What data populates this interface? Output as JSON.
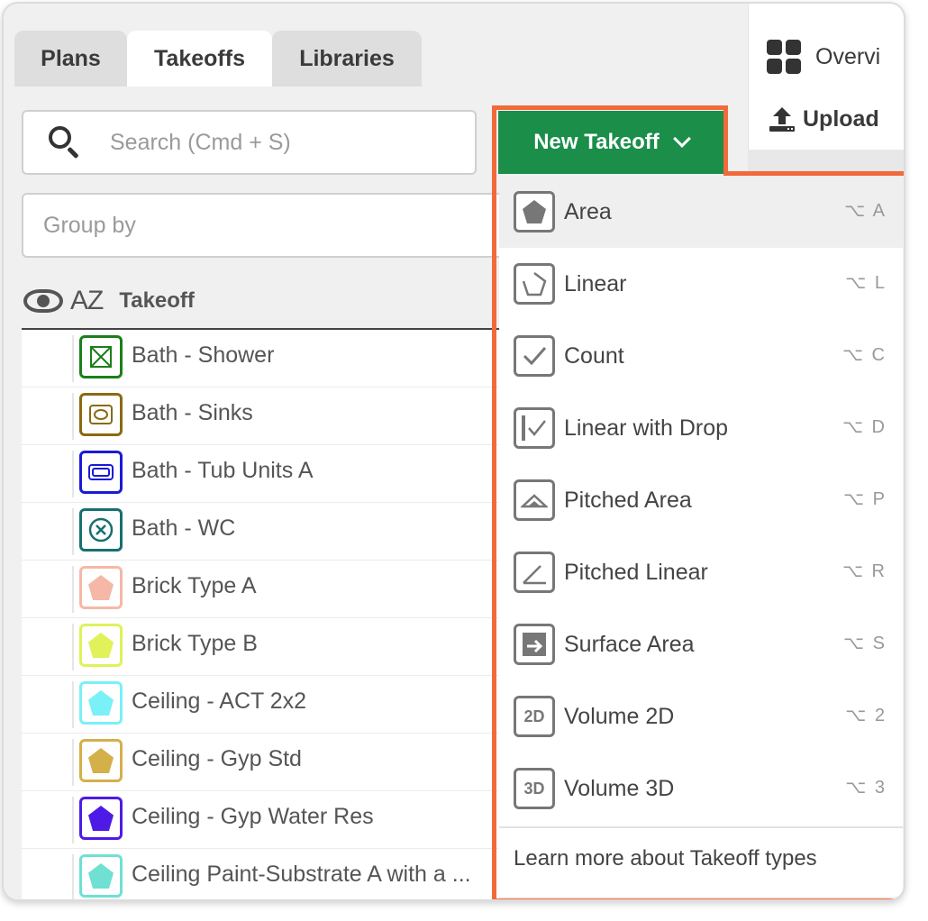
{
  "tabs": [
    {
      "label": "Plans"
    },
    {
      "label": "Takeoffs"
    },
    {
      "label": "Libraries"
    }
  ],
  "active_tab": "Takeoffs",
  "side_panel": {
    "overview_label": "Overvi",
    "upload_label": "Upload"
  },
  "search": {
    "placeholder": "Search (Cmd + S)"
  },
  "group_by": {
    "placeholder": "Group by"
  },
  "list_header": {
    "sort_icon_text": "AZ",
    "column_label": "Takeoff"
  },
  "takeoffs": [
    {
      "label": "Bath - Shower",
      "color": "#1a7f1a",
      "icon": "x-box-icon"
    },
    {
      "label": "Bath - Sinks",
      "color": "#8a6a10",
      "icon": "sink-icon"
    },
    {
      "label": "Bath - Tub Units A",
      "color": "#1a1ad6",
      "icon": "tub-icon"
    },
    {
      "label": "Bath - WC",
      "color": "#17706f",
      "icon": "circle-x-icon"
    },
    {
      "label": "Brick Type A",
      "color": "#f5b8a6",
      "icon": "pentagon-icon"
    },
    {
      "label": "Brick Type B",
      "color": "#e0f15a",
      "icon": "pentagon-icon"
    },
    {
      "label": "Ceiling - ACT 2x2",
      "color": "#7af0f7",
      "icon": "pentagon-icon"
    },
    {
      "label": "Ceiling - Gyp Std",
      "color": "#d4b04a",
      "icon": "pentagon-icon"
    },
    {
      "label": "Ceiling - Gyp Water Res",
      "color": "#4e1be6",
      "icon": "pentagon-icon"
    },
    {
      "label": "Ceiling Paint-Substrate A with a ...",
      "color": "#6fe0d2",
      "icon": "pentagon-icon"
    }
  ],
  "new_takeoff": {
    "button_label": "New Takeoff",
    "items": [
      {
        "label": "Area",
        "shortcut": "⌥ A",
        "icon": "area-icon"
      },
      {
        "label": "Linear",
        "shortcut": "⌥ L",
        "icon": "linear-icon"
      },
      {
        "label": "Count",
        "shortcut": "⌥ C",
        "icon": "count-icon"
      },
      {
        "label": "Linear with Drop",
        "shortcut": "⌥ D",
        "icon": "linear-drop-icon"
      },
      {
        "label": "Pitched Area",
        "shortcut": "⌥ P",
        "icon": "pitched-area-icon"
      },
      {
        "label": "Pitched Linear",
        "shortcut": "⌥ R",
        "icon": "pitched-linear-icon"
      },
      {
        "label": "Surface Area",
        "shortcut": "⌥ S",
        "icon": "surface-area-icon"
      },
      {
        "label": "Volume 2D",
        "shortcut": "⌥ 2",
        "icon": "volume-2d-icon",
        "icon_text": "2D"
      },
      {
        "label": "Volume 3D",
        "shortcut": "⌥ 3",
        "icon": "volume-3d-icon",
        "icon_text": "3D"
      }
    ],
    "learn_more": "Learn more about Takeoff types"
  },
  "colors": {
    "accent_green": "#1b8e4a",
    "highlight_orange": "#f26a3a"
  }
}
